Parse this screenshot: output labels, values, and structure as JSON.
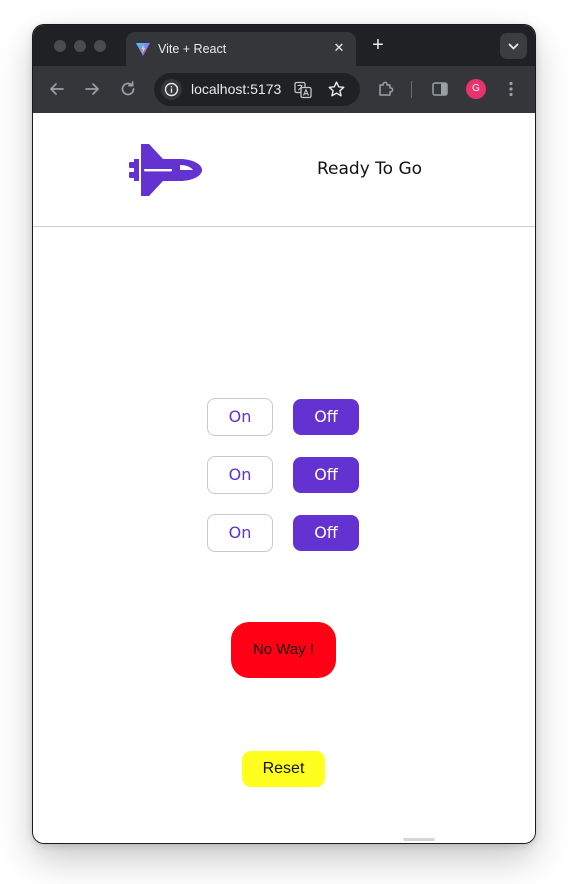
{
  "browser": {
    "tab_title": "Vite + React",
    "tab_close_glyph": "✕",
    "new_tab_glyph": "+",
    "address": "localhost:5173",
    "profile_initial": "G",
    "icons": {
      "traffic_lights": [
        "close-dot",
        "minimize-dot",
        "zoom-dot"
      ],
      "favicon": "vite-logo-icon",
      "tab_search": "chevron-down-icon",
      "nav": [
        "back-arrow-icon",
        "forward-arrow-icon",
        "reload-icon"
      ],
      "omnibox": [
        "site-info-icon",
        "translate-icon",
        "bookmark-star-icon"
      ],
      "toolbar": [
        "extensions-puzzle-icon",
        "side-panel-icon",
        "more-menu-icon"
      ]
    },
    "colors": {
      "frame": "#202124",
      "toolbar": "#35363a",
      "avatar": "#e8336f"
    }
  },
  "header": {
    "logo_icon": "space-shuttle-icon",
    "status": "Ready To Go"
  },
  "switches": [
    {
      "on_label": "On",
      "off_label": "Off",
      "selected": "Off"
    },
    {
      "on_label": "On",
      "off_label": "Off",
      "selected": "Off"
    },
    {
      "on_label": "On",
      "off_label": "Off",
      "selected": "Off"
    }
  ],
  "launch_button": {
    "label": "No Way !",
    "color": "#ff0015"
  },
  "reset_button": {
    "label": "Reset",
    "color": "#ffff1f"
  },
  "colors": {
    "accent": "#6532d2",
    "accent_text": "#5b32d4"
  }
}
